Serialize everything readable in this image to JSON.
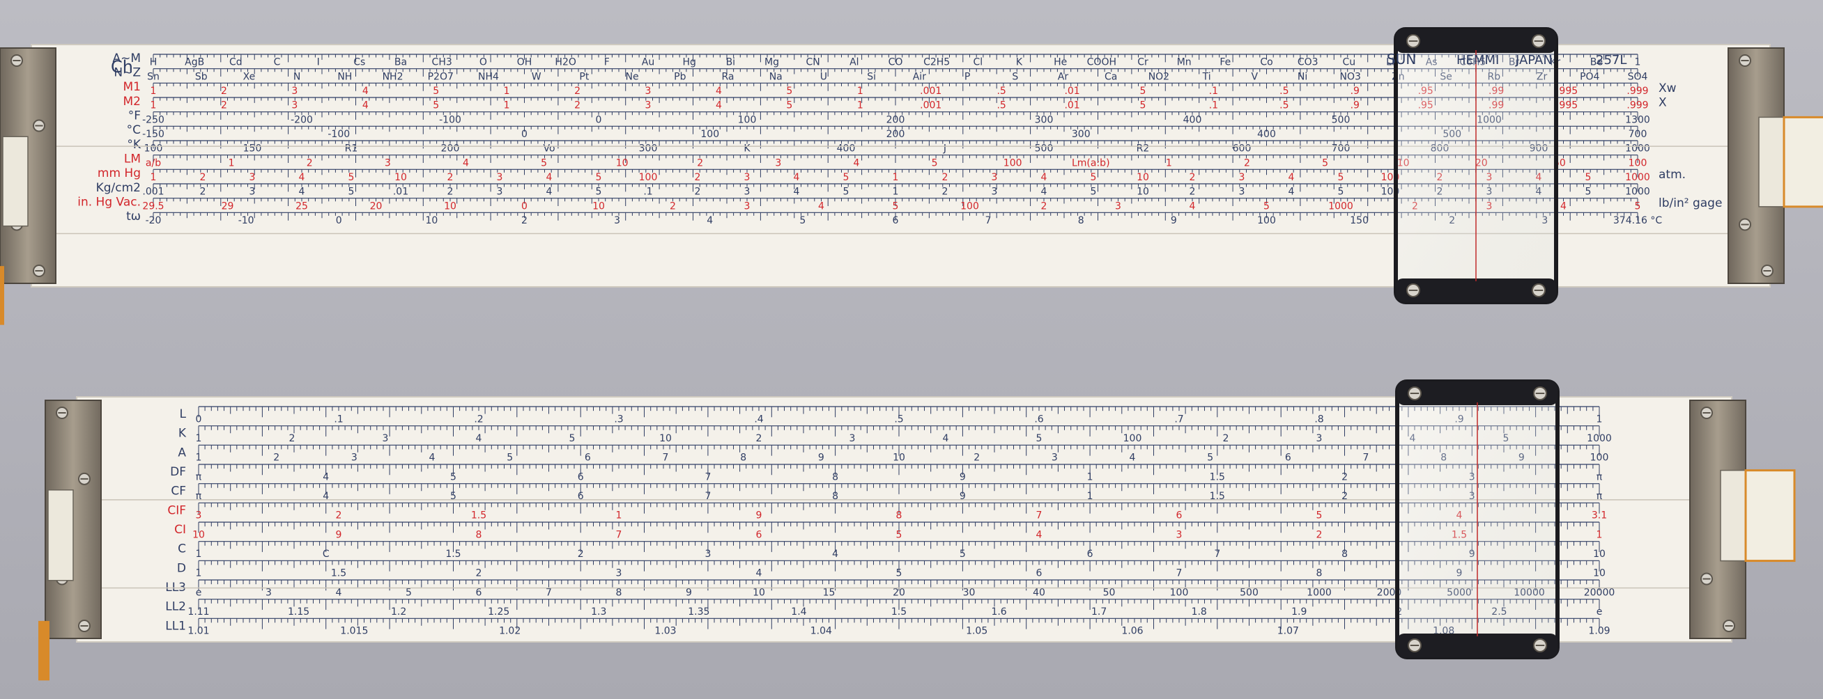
{
  "colors": {
    "ink": "#2f3d63",
    "red": "#d2262b",
    "body": "#f4f1ea",
    "metal": "#8d8374"
  },
  "rule1": {
    "brand": "SUN",
    "brand2": "HEMMI",
    "origin": "JAPAN",
    "model": "257L",
    "ch_label": "Ch",
    "scales": [
      {
        "id": "am",
        "label": "A~M",
        "color": "ink",
        "values": [
          "H",
          "AgB",
          "Cd",
          "C",
          "I",
          "Cs",
          "Ba",
          "CH3",
          "O",
          "OH",
          "H2O",
          "F",
          "Au",
          "Hg",
          "Bi",
          "Mg",
          "CN",
          "Al",
          "CO",
          "C2H5",
          "Cl",
          "K",
          "He",
          "COOH",
          "Cr",
          "Mn",
          "Fe",
          "Co",
          "CO3",
          "Cu",
          "Li",
          "As",
          "C6H5",
          "Br",
          "Kr",
          "Be",
          "1"
        ]
      },
      {
        "id": "nz",
        "label": "N~Z",
        "color": "ink",
        "values": [
          "Sn",
          "Sb",
          "Xe",
          "N",
          "NH",
          "NH2",
          "P2O7",
          "NH4",
          "W",
          "Pt",
          "Ne",
          "Pb",
          "Ra",
          "Na",
          "U",
          "Si",
          "Air",
          "P",
          "S",
          "Ar",
          "Ca",
          "NO2",
          "Ti",
          "V",
          "Ni",
          "NO3",
          "Zn",
          "Se",
          "Rb",
          "Zr",
          "PO4",
          "SO4"
        ]
      },
      {
        "id": "m1",
        "label": "M1",
        "color": "red",
        "right": "Xw",
        "values": [
          "1",
          "2",
          "3",
          "4",
          "5",
          "1",
          "2",
          "3",
          "4",
          "5",
          "1",
          ".001",
          ".5",
          ".01",
          "5",
          ".1",
          ".5",
          ".9",
          ".95",
          ".99",
          ".995",
          ".999"
        ]
      },
      {
        "id": "m2",
        "label": "M2",
        "color": "red",
        "right": "X",
        "values": [
          "1",
          "2",
          "3",
          "4",
          "5",
          "1",
          "2",
          "3",
          "4",
          "5",
          "1",
          ".001",
          ".5",
          ".01",
          "5",
          ".1",
          ".5",
          ".9",
          ".95",
          ".99",
          ".995",
          ".999"
        ]
      },
      {
        "id": "f",
        "label": "°F",
        "color": "ink",
        "values": [
          "-250",
          "-200",
          "-100",
          "0",
          "100",
          "200",
          "300",
          "400",
          "500",
          "1000",
          "1300"
        ]
      },
      {
        "id": "c",
        "label": "°C",
        "color": "ink",
        "values": [
          "-150",
          "-100",
          "0",
          "100",
          "200",
          "300",
          "400",
          "500",
          "700"
        ]
      },
      {
        "id": "k",
        "label": "°K",
        "color": "ink",
        "values": [
          "100",
          "150",
          "R1",
          "200",
          "Vo",
          "300",
          "K",
          "400",
          "J",
          "500",
          "R2",
          "600",
          "700",
          "800",
          "900",
          "1000"
        ]
      },
      {
        "id": "lm",
        "label": "LM",
        "color": "red",
        "values": [
          "a/b",
          "1",
          "2",
          "3",
          "4",
          "5",
          "10",
          "2",
          "3",
          "4",
          "5",
          "100",
          "Lm(a:b)",
          "1",
          "2",
          "5",
          "10",
          "20",
          "50",
          "100"
        ]
      },
      {
        "id": "mmhg",
        "label": "mm Hg",
        "color": "red",
        "right": "atm.",
        "values": [
          "1",
          "2",
          "3",
          "4",
          "5",
          "10",
          "2",
          "3",
          "4",
          "5",
          "100",
          "2",
          "3",
          "4",
          "5",
          "1",
          "2",
          "3",
          "4",
          "5",
          "10",
          "2",
          "3",
          "4",
          "5",
          "100",
          "2",
          "3",
          "4",
          "5",
          "1000"
        ]
      },
      {
        "id": "kg",
        "label": "Kg/cm2",
        "color": "ink",
        "values": [
          ".001",
          "2",
          "3",
          "4",
          "5",
          ".01",
          "2",
          "3",
          "4",
          "5",
          ".1",
          "2",
          "3",
          "4",
          "5",
          "1",
          "2",
          "3",
          "4",
          "5",
          "10",
          "2",
          "3",
          "4",
          "5",
          "100",
          "2",
          "3",
          "4",
          "5",
          "1000"
        ]
      },
      {
        "id": "inhg",
        "label": "in. Hg Vac.",
        "color": "red",
        "right": "lb/in² gage",
        "values": [
          "29.5",
          "29",
          "25",
          "20",
          "10",
          "0",
          "10",
          "2",
          "3",
          "4",
          "5",
          "100",
          "2",
          "3",
          "4",
          "5",
          "1000",
          "2",
          "3",
          "4",
          "5"
        ]
      },
      {
        "id": "tw",
        "label": "tω",
        "color": "ink",
        "values": [
          "-20",
          "-10",
          "0",
          "10",
          "2",
          "3",
          "4",
          "5",
          "6",
          "7",
          "8",
          "9",
          "100",
          "150",
          "2",
          "3",
          "374.16 °C"
        ]
      }
    ]
  },
  "rule2": {
    "scales": [
      {
        "id": "L",
        "label": "L",
        "color": "ink",
        "values": [
          "0",
          ".1",
          ".2",
          ".3",
          ".4",
          ".5",
          ".6",
          ".7",
          ".8",
          ".9",
          "1"
        ]
      },
      {
        "id": "K",
        "label": "K",
        "color": "ink",
        "values": [
          "1",
          "2",
          "3",
          "4",
          "5",
          "10",
          "2",
          "3",
          "4",
          "5",
          "100",
          "2",
          "3",
          "4",
          "5",
          "1000"
        ]
      },
      {
        "id": "A",
        "label": "A",
        "color": "ink",
        "values": [
          "1",
          "2",
          "3",
          "4",
          "5",
          "6",
          "7",
          "8",
          "9",
          "10",
          "2",
          "3",
          "4",
          "5",
          "6",
          "7",
          "8",
          "9",
          "100"
        ]
      },
      {
        "id": "DF",
        "label": "DF",
        "color": "ink",
        "values": [
          "π",
          "4",
          "5",
          "6",
          "7",
          "8",
          "9",
          "1",
          "1.5",
          "2",
          "3",
          "π"
        ]
      },
      {
        "id": "CF",
        "label": "CF",
        "color": "ink",
        "values": [
          "π",
          "4",
          "5",
          "6",
          "7",
          "8",
          "9",
          "1",
          "1.5",
          "2",
          "3",
          "π"
        ]
      },
      {
        "id": "CIF",
        "label": "CIF",
        "color": "red",
        "values": [
          "3",
          "2",
          "1.5",
          "1",
          "9",
          "8",
          "7",
          "6",
          "5",
          "4",
          "3.1"
        ]
      },
      {
        "id": "CI",
        "label": "CI",
        "color": "red",
        "values": [
          "10",
          "9",
          "8",
          "7",
          "6",
          "5",
          "4",
          "3",
          "2",
          "1.5",
          "1"
        ]
      },
      {
        "id": "C",
        "label": "C",
        "color": "ink",
        "values": [
          "1",
          "C",
          "1.5",
          "2",
          "3",
          "4",
          "5",
          "6",
          "7",
          "8",
          "9",
          "10"
        ]
      },
      {
        "id": "D",
        "label": "D",
        "color": "ink",
        "values": [
          "1",
          "1.5",
          "2",
          "3",
          "4",
          "5",
          "6",
          "7",
          "8",
          "9",
          "10"
        ]
      },
      {
        "id": "LL3",
        "label": "LL3",
        "color": "ink",
        "values": [
          "e",
          "3",
          "4",
          "5",
          "6",
          "7",
          "8",
          "9",
          "10",
          "15",
          "20",
          "30",
          "40",
          "50",
          "100",
          "500",
          "1000",
          "2000",
          "5000",
          "10000",
          "20000"
        ]
      },
      {
        "id": "LL2",
        "label": "LL2",
        "color": "ink",
        "values": [
          "1.11",
          "1.15",
          "1.2",
          "1.25",
          "1.3",
          "1.35",
          "1.4",
          "1.5",
          "1.6",
          "1.7",
          "1.8",
          "1.9",
          "2",
          "2.5",
          "e"
        ]
      },
      {
        "id": "LL1",
        "label": "LL1",
        "color": "ink",
        "values": [
          "1.01",
          "1.015",
          "1.02",
          "1.03",
          "1.04",
          "1.05",
          "1.06",
          "1.07",
          "1.08",
          "1.09"
        ]
      }
    ]
  }
}
